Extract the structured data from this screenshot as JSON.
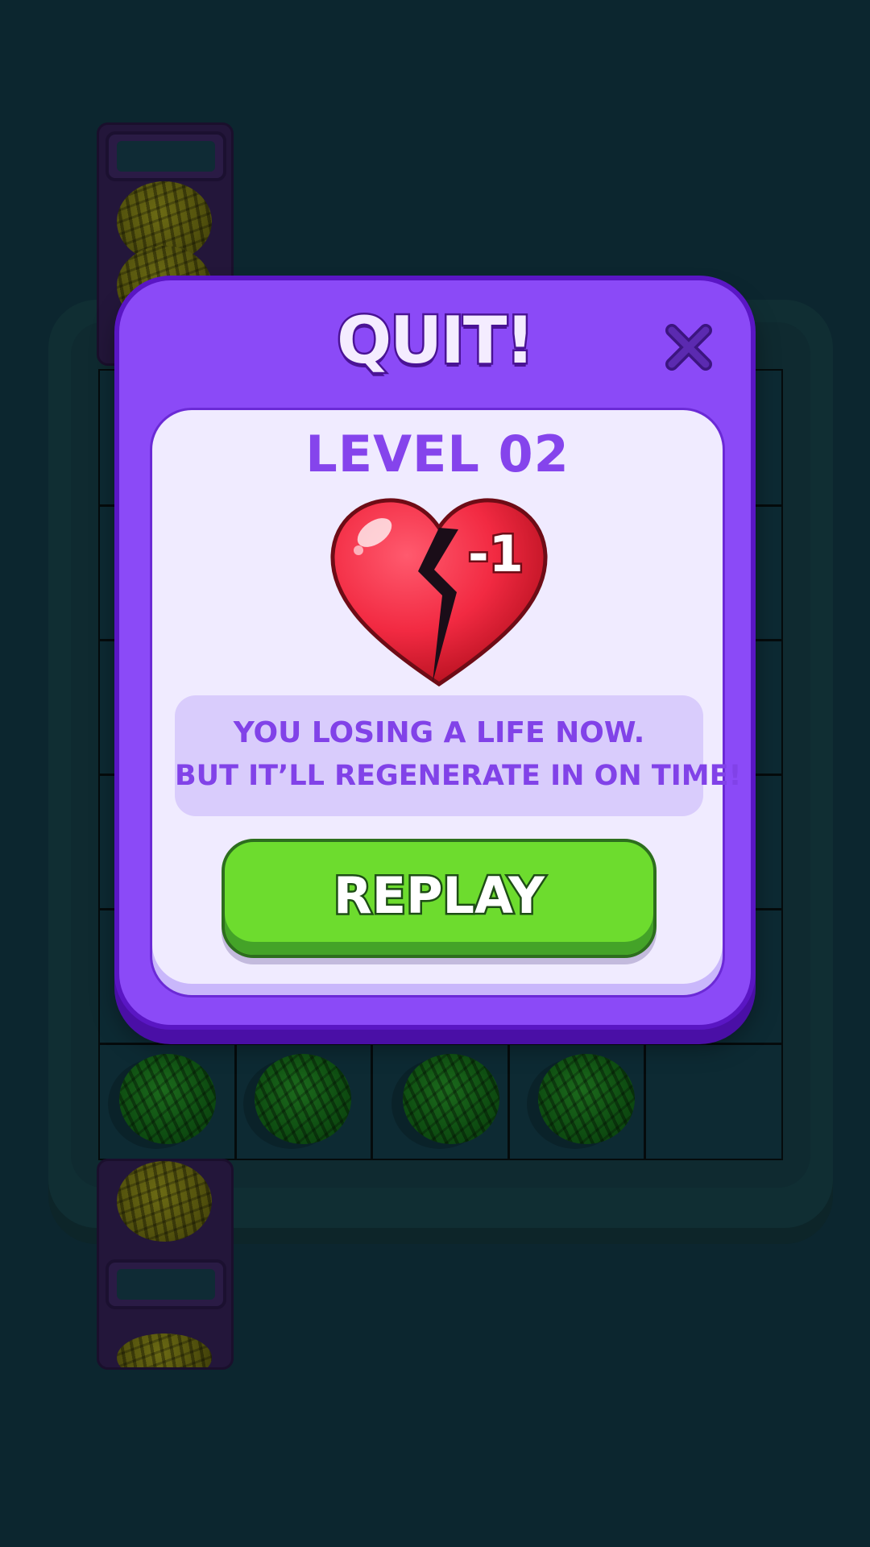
{
  "dialog": {
    "title": "QUIT!",
    "level_label": "LEVEL 02",
    "heart_badge": "-1",
    "message_line_1": "YOU LOSING A LIFE NOW.",
    "message_line_2": "BUT IT’LL REGENERATE IN ON TIME!",
    "replay_label": "REPLAY",
    "close_icon": "close-icon",
    "heart_icon": "broken-heart-icon"
  },
  "board": {
    "columns": 5,
    "rows": 6,
    "yarn_colors": [
      "green",
      "yellow"
    ]
  },
  "colors": {
    "modal_purple": "#8b4af7",
    "card_background": "#f0ebff",
    "text_purple": "#8544ec",
    "replay_green": "#6ddc2e",
    "heart_red": "#f22a42",
    "background": "#0c262f"
  }
}
